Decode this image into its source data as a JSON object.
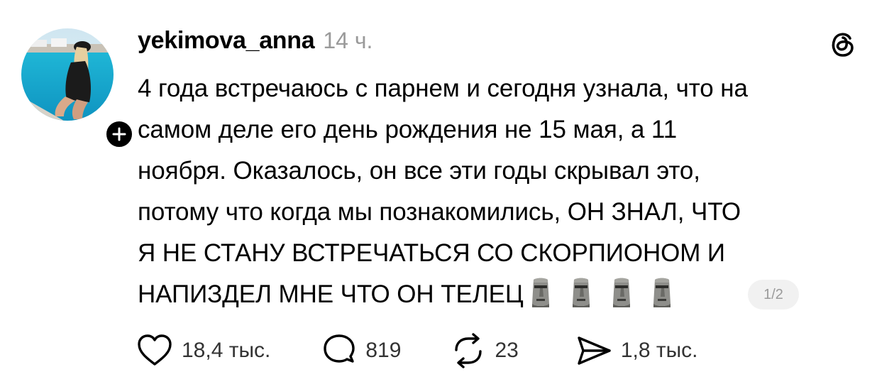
{
  "post": {
    "username": "yekimova_anna",
    "time": "14 ч.",
    "text_lines": [
      "4 года встречаюсь с парнем и сегодня узнала, что на",
      "самом деле его день рождения не 15 мая, а 11",
      "ноября. Оказалось, он все эти годы скрывал это,",
      "потому что когда мы познакомились, ОН ЗНАЛ, ЧТО",
      "Я НЕ СТАНУ ВСТРЕЧАТЬСЯ СО СКОРПИОНОМ И",
      "НАПИЗДЕЛ МНЕ ЧТО ОН ТЕЛЕЦ"
    ],
    "emojis": [
      "moai",
      "moai",
      "moai",
      "moai"
    ],
    "page_indicator": "1/2"
  },
  "actions": {
    "likes": "18,4 тыс.",
    "replies": "819",
    "reposts": "23",
    "shares": "1,8 тыс."
  },
  "icons": {
    "avatar": "avatar-photo",
    "follow": "plus-icon",
    "app_logo": "threads-logo-icon",
    "like": "heart-icon",
    "reply": "comment-bubble-icon",
    "repost": "repost-arrows-icon",
    "share": "send-arrow-icon"
  }
}
